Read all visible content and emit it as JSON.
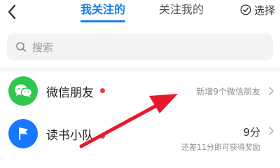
{
  "header": {
    "tabs": [
      {
        "label": "我关注的",
        "active": true
      },
      {
        "label": "关注我的",
        "active": false
      }
    ],
    "select_label": "选择",
    "accent_color": "#1a7df0"
  },
  "search": {
    "placeholder": "搜索"
  },
  "list": {
    "items": [
      {
        "title": "微信朋友",
        "icon": "wechat-icon",
        "icon_color": "#2dc84d",
        "has_new_badge": true,
        "subtext": "新增9个微信朋友"
      },
      {
        "title": "读书小队",
        "icon": "flag-icon",
        "icon_color": "#1677ff",
        "has_new_badge": true,
        "score": "9分",
        "subtext": "还差11分即可获得奖励"
      }
    ]
  },
  "annotation": {
    "arrow_color": "#e8192c"
  }
}
